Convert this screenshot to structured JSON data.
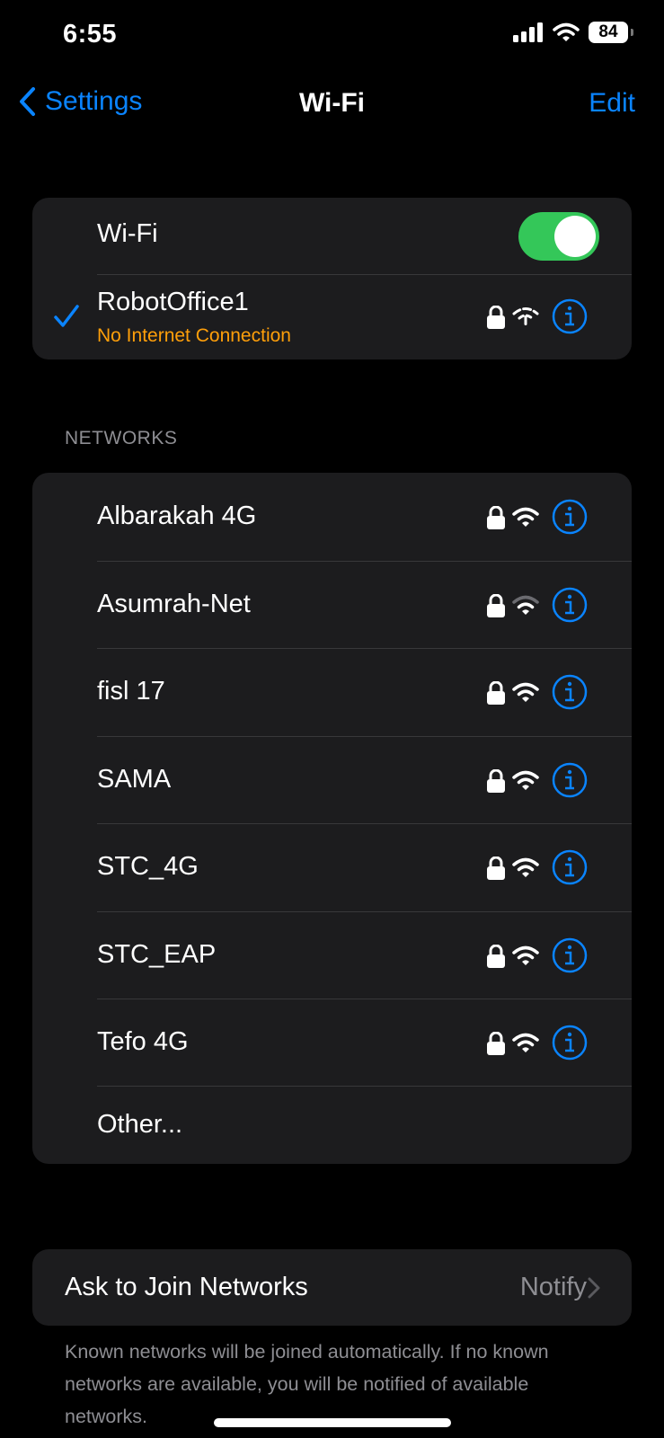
{
  "status": {
    "time": "6:55",
    "battery": "84"
  },
  "nav": {
    "back_label": "Settings",
    "title": "Wi-Fi",
    "edit_label": "Edit"
  },
  "wifi_card": {
    "toggle_label": "Wi-Fi",
    "toggle_on": true,
    "connected": {
      "name": "RobotOffice1",
      "status": "No Internet Connection"
    }
  },
  "networks": {
    "header": "NETWORKS",
    "items": [
      {
        "name": "Albarakah 4G"
      },
      {
        "name": "Asumrah-Net"
      },
      {
        "name": "fisl 17"
      },
      {
        "name": "SAMA"
      },
      {
        "name": "STC_4G"
      },
      {
        "name": "STC_EAP"
      },
      {
        "name": "Tefo 4G"
      }
    ],
    "other_label": "Other..."
  },
  "ask_join": {
    "label": "Ask to Join Networks",
    "value": "Notify",
    "footer": "Known networks will be joined automatically. If no known networks are available, you will be notified of available networks."
  },
  "colors": {
    "accent": "#0a84ff",
    "warning": "#ff9f0a",
    "toggle_on": "#34c759",
    "card": "#1c1c1e"
  }
}
